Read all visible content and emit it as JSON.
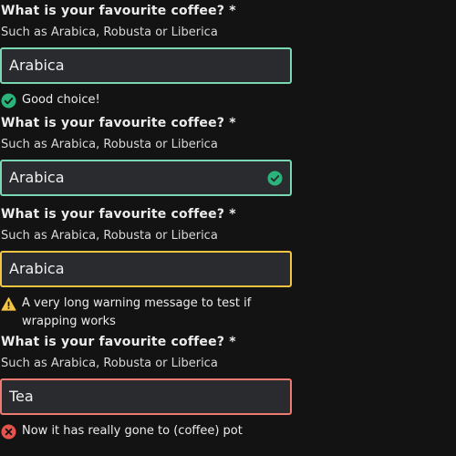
{
  "fields": [
    {
      "label": "What is your favourite coffee? *",
      "hint": "Such as Arabica, Robusta or Liberica",
      "value": "Arabica",
      "state": "success",
      "message": "Good choice!"
    },
    {
      "label": "What is your favourite coffee? *",
      "hint": "Such as Arabica, Robusta or Liberica",
      "value": "Arabica",
      "state": "success"
    },
    {
      "label": "What is your favourite coffee? *",
      "hint": "Such as Arabica, Robusta or Liberica",
      "value": "Arabica",
      "state": "warning",
      "message": "A very long warning message to test if wrapping works"
    },
    {
      "label": "What is your favourite coffee? *",
      "hint": "Such as Arabica, Robusta or Liberica",
      "value": "Tea",
      "state": "error",
      "message": "Now it has really gone to (coffee) pot"
    }
  ],
  "colors": {
    "background": "#131313",
    "success": "#2ab37a",
    "warning": "#f4c542",
    "error": "#e5534b"
  }
}
